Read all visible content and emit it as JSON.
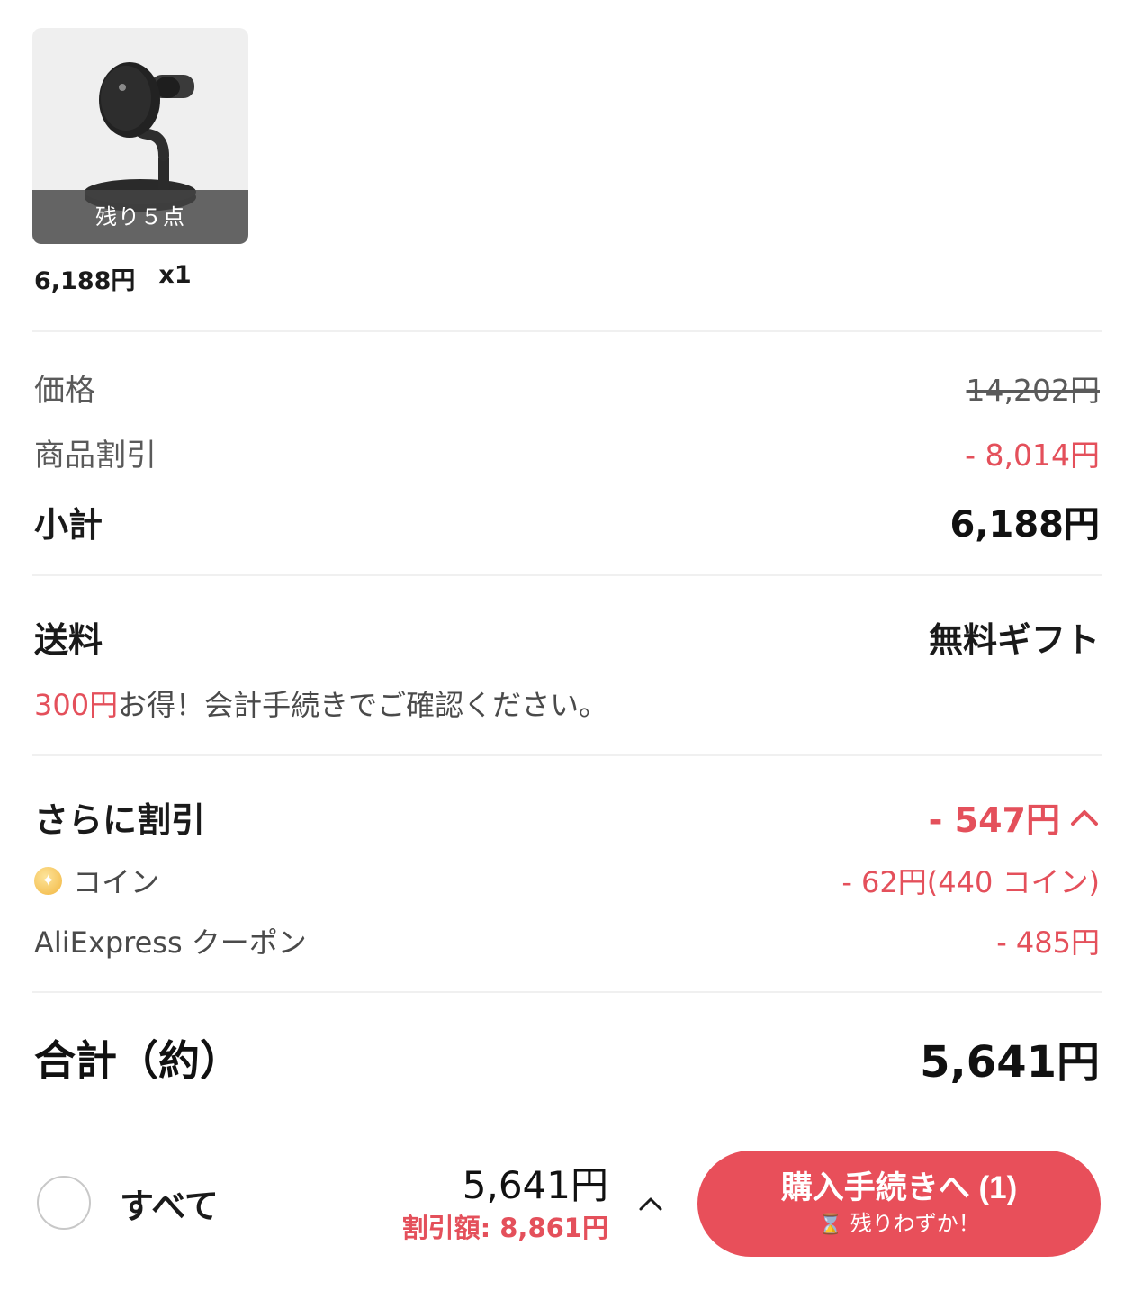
{
  "product": {
    "image_alt": "magnetic phone charging stand",
    "stock_badge": "残り５点",
    "price": "6,188円",
    "quantity": "x1"
  },
  "summary": {
    "price_label": "価格",
    "price_original": "14,202円",
    "product_discount_label": "商品割引",
    "product_discount_value": "- 8,014円",
    "subtotal_label": "小計",
    "subtotal_value": "6,188円"
  },
  "shipping": {
    "label": "送料",
    "value": "無料ギフト",
    "note_amount": "300円",
    "note_text": "お得！会計手続きでご確認ください。"
  },
  "extra_discount": {
    "label": "さらに割引",
    "value": "- 547円",
    "coin_label": "コイン",
    "coin_icon": "coin-icon",
    "coin_value": "- 62円(440 コイン)",
    "coupon_label": "AliExpress クーポン",
    "coupon_value": "- 485円"
  },
  "total": {
    "label": "合計（約）",
    "value": "5,641円"
  },
  "bottom_bar": {
    "select_all_label": "すべて",
    "total_amount": "5,641円",
    "saved_amount": "割引額: 8,861円",
    "checkout_label": "購入手続きへ (1)",
    "checkout_sub": "残りわずか！",
    "colors": {
      "accent": "#e84f5a",
      "discount_text": "#e4505b"
    }
  }
}
